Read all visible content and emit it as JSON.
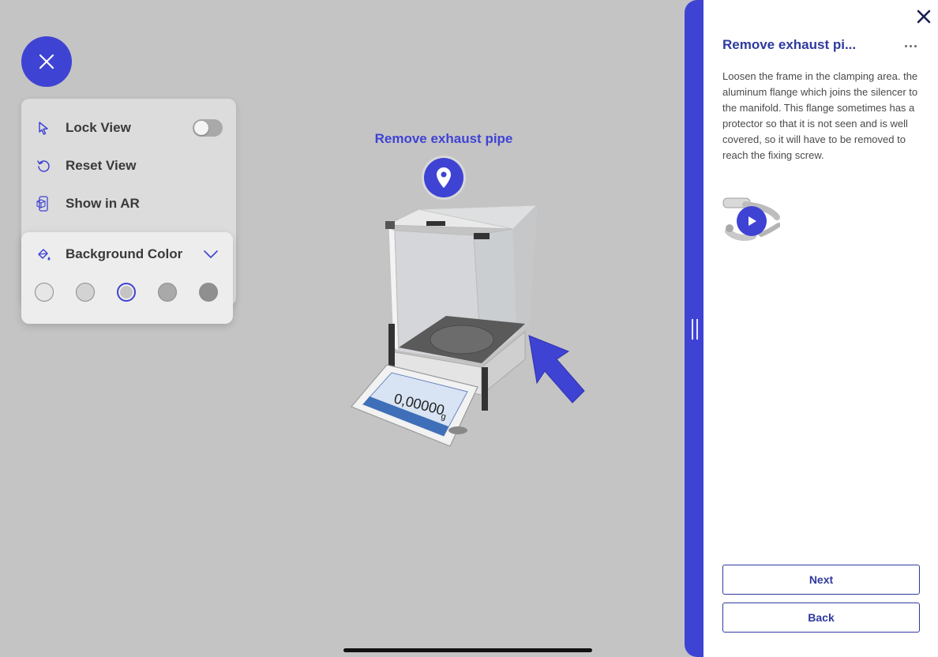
{
  "controls": {
    "lock_view_label": "Lock View",
    "lock_view_enabled": false,
    "reset_view_label": "Reset View",
    "show_ar_label": "Show in AR",
    "background_color_label": "Background Color",
    "swatches": [
      {
        "color": "#e6e6e6",
        "selected": false
      },
      {
        "color": "#d3d3d3",
        "selected": false
      },
      {
        "color": "#c4c4c4",
        "selected": true
      },
      {
        "color": "#a9a9a9",
        "selected": false
      },
      {
        "color": "#8f8f8f",
        "selected": false
      }
    ]
  },
  "scene": {
    "hotspot_label": "Remove exhaust pipe",
    "display_reading": "0,00000",
    "display_unit": "g"
  },
  "panel": {
    "title": "Remove exhaust pi...",
    "description": "Loosen the frame in the clamping area. the aluminum flange which joins the silencer to the manifold. This flange sometimes has a protector so that it is not seen and is well covered, so it will have to be removed to reach the fixing screw.",
    "next_label": "Next",
    "back_label": "Back"
  },
  "colors": {
    "accent": "#3f43d3",
    "panel_title": "#2f3a9e",
    "viewport_bg": "#c4c4c4"
  }
}
